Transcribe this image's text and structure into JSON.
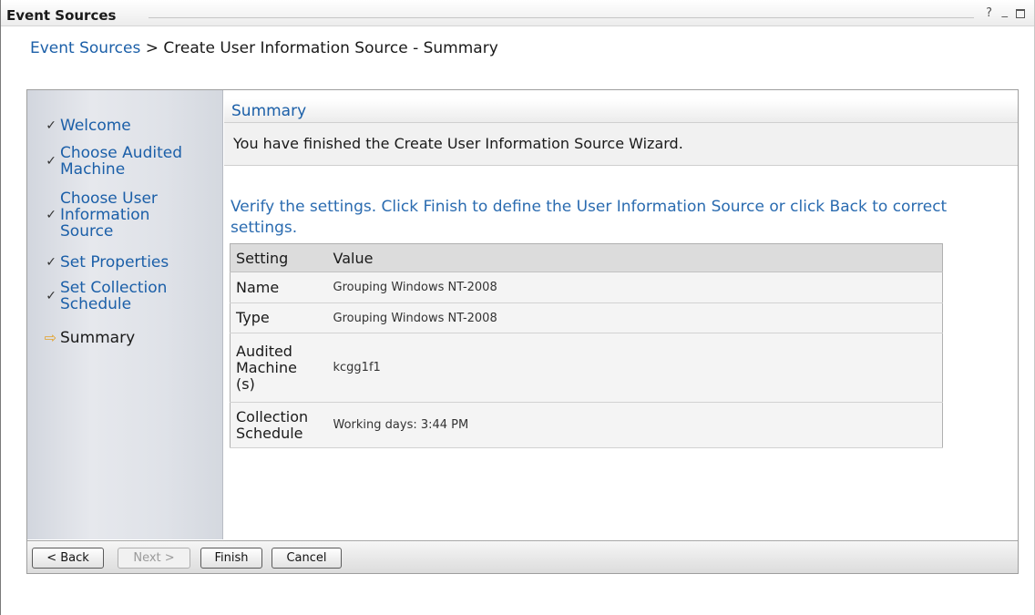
{
  "window": {
    "title": "Event Sources",
    "help": "?",
    "minimize": "_"
  },
  "breadcrumb": {
    "link": "Event Sources",
    "separator": " > ",
    "current": "Create User Information Source - Summary"
  },
  "nav": {
    "items": [
      {
        "mark": "✓",
        "label": "Welcome"
      },
      {
        "mark": "✓",
        "label": "Choose Audited Machine"
      },
      {
        "mark": "✓",
        "label": "Choose User Information Source"
      },
      {
        "mark": "✓",
        "label": "Set Properties"
      },
      {
        "mark": "✓",
        "label": "Set Collection Schedule"
      },
      {
        "mark": "⇨",
        "label": "Summary"
      }
    ]
  },
  "summary": {
    "heading": "Summary",
    "description": "You have finished the Create User Information Source Wizard.",
    "instruction": "Verify the settings. Click Finish to define the User Information Source or click Back to correct settings."
  },
  "table": {
    "headers": [
      "Setting",
      "Value"
    ],
    "rows": [
      {
        "key": "Name",
        "value": "Grouping Windows NT-2008"
      },
      {
        "key": "Type",
        "value": "Grouping Windows NT-2008"
      },
      {
        "key": "Audited Machine (s)",
        "value": "kcgg1f1"
      },
      {
        "key": "Collection Schedule",
        "value": "Working days: 3:44 PM"
      }
    ]
  },
  "buttons": {
    "back": "< Back",
    "next": "Next >",
    "finish": "Finish",
    "cancel": "Cancel"
  }
}
